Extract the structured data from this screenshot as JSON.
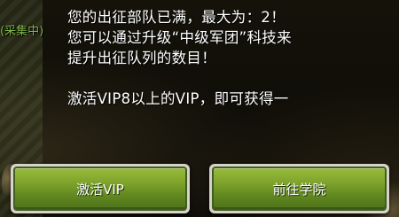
{
  "background": {
    "left_tag": "(采集中)"
  },
  "dialog": {
    "lines": [
      "您的出征部队已满，最大为：2！",
      "您可以通过升级“中级军团”科技来",
      "提升出征队列的数目！",
      "激活VIP8以上的VIP，即可获得一"
    ]
  },
  "buttons": {
    "activate_vip": "激活VIP",
    "go_academy": "前往学院"
  },
  "colors": {
    "button_green": "#7fa42c",
    "button_border": "#d7d3c8",
    "text": "#ffffff",
    "tag_green": "#7fb84a"
  }
}
